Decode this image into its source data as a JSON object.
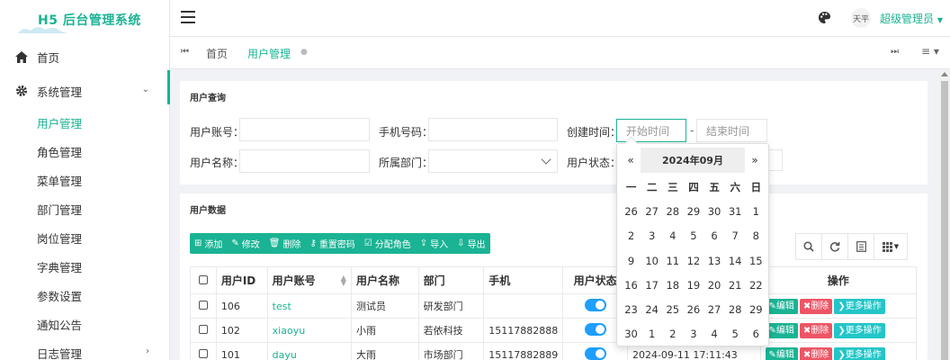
{
  "app": {
    "title": "H5 后台管理系统"
  },
  "sidebar": {
    "home": "首页",
    "system": "系统管理",
    "items": [
      "用户管理",
      "角色管理",
      "菜单管理",
      "部门管理",
      "岗位管理",
      "字典管理",
      "参数设置",
      "通知公告",
      "日志管理"
    ]
  },
  "header": {
    "avatar_text": "天平",
    "user": "超级管理员"
  },
  "tabs": {
    "home": "首页",
    "active": "用户管理"
  },
  "query": {
    "title": "用户查询",
    "account_label": "用户账号：",
    "phone_label": "手机号码：",
    "created_label": "创建时间：",
    "start_placeholder": "开始时间",
    "sep": "-",
    "end_placeholder": "结束时间",
    "name_label": "用户名称：",
    "dept_label": "所属部门：",
    "status_label": "用户状态："
  },
  "data_panel": {
    "title": "用户数据"
  },
  "toolbar": {
    "add": "添加",
    "edit": "修改",
    "delete": "删除",
    "reset": "重置密码",
    "role": "分配角色",
    "import": "导入",
    "export": "导出"
  },
  "table": {
    "headers": {
      "id": "用户ID",
      "account": "用户账号",
      "name": "用户名称",
      "dept": "部门",
      "phone": "手机",
      "status": "用户状态",
      "ops": "操作"
    },
    "rows": [
      {
        "id": "106",
        "account": "test",
        "name": "测试员",
        "dept": "研发部门",
        "phone": "",
        "time": ""
      },
      {
        "id": "102",
        "account": "xiaoyu",
        "name": "小雨",
        "dept": "若依科技",
        "phone": "15117882888",
        "time": ""
      },
      {
        "id": "101",
        "account": "dayu",
        "name": "大雨",
        "dept": "市场部门",
        "phone": "15117882889",
        "time": "2024-09-11 17:11:43"
      }
    ],
    "op_edit": "编辑",
    "op_del": "删除",
    "op_more": "更多操作"
  },
  "datepicker": {
    "prev": "«",
    "next": "»",
    "month": "2024年09月",
    "weekdays": [
      "一",
      "二",
      "三",
      "四",
      "五",
      "六",
      "日"
    ],
    "weeks": [
      [
        "26",
        "27",
        "28",
        "29",
        "30",
        "31",
        "1"
      ],
      [
        "2",
        "3",
        "4",
        "5",
        "6",
        "7",
        "8"
      ],
      [
        "9",
        "10",
        "11",
        "12",
        "13",
        "14",
        "15"
      ],
      [
        "16",
        "17",
        "18",
        "19",
        "20",
        "21",
        "22"
      ],
      [
        "23",
        "24",
        "25",
        "26",
        "27",
        "28",
        "29"
      ],
      [
        "30",
        "1",
        "2",
        "3",
        "4",
        "5",
        "6"
      ]
    ]
  },
  "colors": {
    "accent": "#1ab394",
    "danger": "#ed5565",
    "info": "#23c6c8",
    "toggle": "#1e9fff"
  }
}
